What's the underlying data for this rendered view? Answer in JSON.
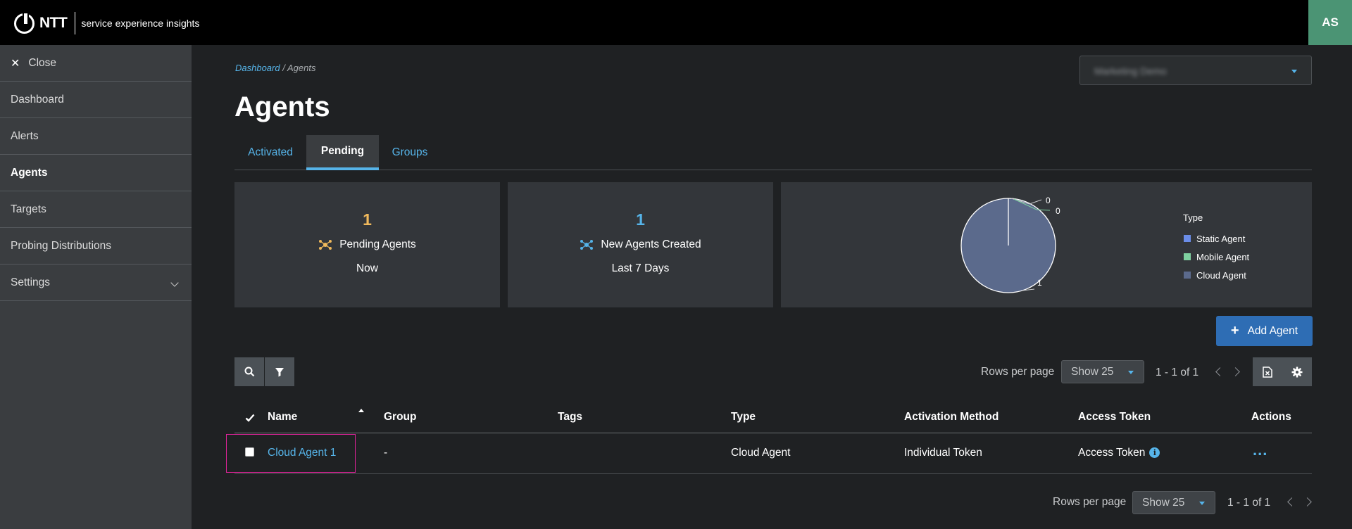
{
  "header": {
    "brand": "NTT",
    "tagline": "service experience insights",
    "avatar_initials": "AS"
  },
  "sidebar": {
    "close_label": "Close",
    "items": [
      {
        "label": "Dashboard",
        "icon": null
      },
      {
        "label": "Alerts"
      },
      {
        "label": "Agents",
        "active": true
      },
      {
        "label": "Targets"
      },
      {
        "label": "Probing Distributions"
      },
      {
        "label": "Settings",
        "icon": "chevron-down-icon"
      }
    ]
  },
  "breadcrumb": {
    "parent": "Dashboard",
    "separator": "/",
    "current": "Agents"
  },
  "org_selector": {
    "value": "Marketing Demo"
  },
  "page_title": "Agents",
  "tabs": [
    {
      "label": "Activated"
    },
    {
      "label": "Pending",
      "active": true
    },
    {
      "label": "Groups"
    }
  ],
  "cards": {
    "pending": {
      "value": "1",
      "label": "Pending Agents",
      "sub": "Now",
      "color": "#f0b95c"
    },
    "created": {
      "value": "1",
      "label": "New Agents Created",
      "sub": "Last 7 Days",
      "color": "#56b4e9"
    }
  },
  "chart_data": {
    "type": "pie",
    "legend_title": "Type",
    "legend_placement": "right",
    "slices": [
      {
        "name": "Static Agent",
        "value": 0,
        "label": "0",
        "color": "#6b8de8"
      },
      {
        "name": "Mobile Agent",
        "value": 0,
        "label": "0",
        "color": "#7fd1a0"
      },
      {
        "name": "Cloud Agent",
        "value": 1,
        "label": "1",
        "color": "#5b6a8c"
      }
    ]
  },
  "add_agent_label": "Add Agent",
  "toolbar": {
    "search_icon": "search-icon",
    "filter_icon": "filter-icon",
    "export_icon": "excel-export-icon",
    "settings_icon": "gear-icon"
  },
  "pagination_top": {
    "rows_label": "Rows per page",
    "rows_value": "Show 25",
    "range": "1 - 1 of 1"
  },
  "pagination_bottom": {
    "rows_label": "Rows per page",
    "rows_value": "Show 25",
    "range": "1 - 1 of 1"
  },
  "table": {
    "columns": [
      "Name",
      "Group",
      "Tags",
      "Type",
      "Activation Method",
      "Access Token",
      "Actions"
    ],
    "rows": [
      {
        "name": "Cloud Agent 1",
        "group": "-",
        "tags": "",
        "type": "Cloud Agent",
        "activation": "Individual Token",
        "token": "Access Token"
      }
    ]
  }
}
